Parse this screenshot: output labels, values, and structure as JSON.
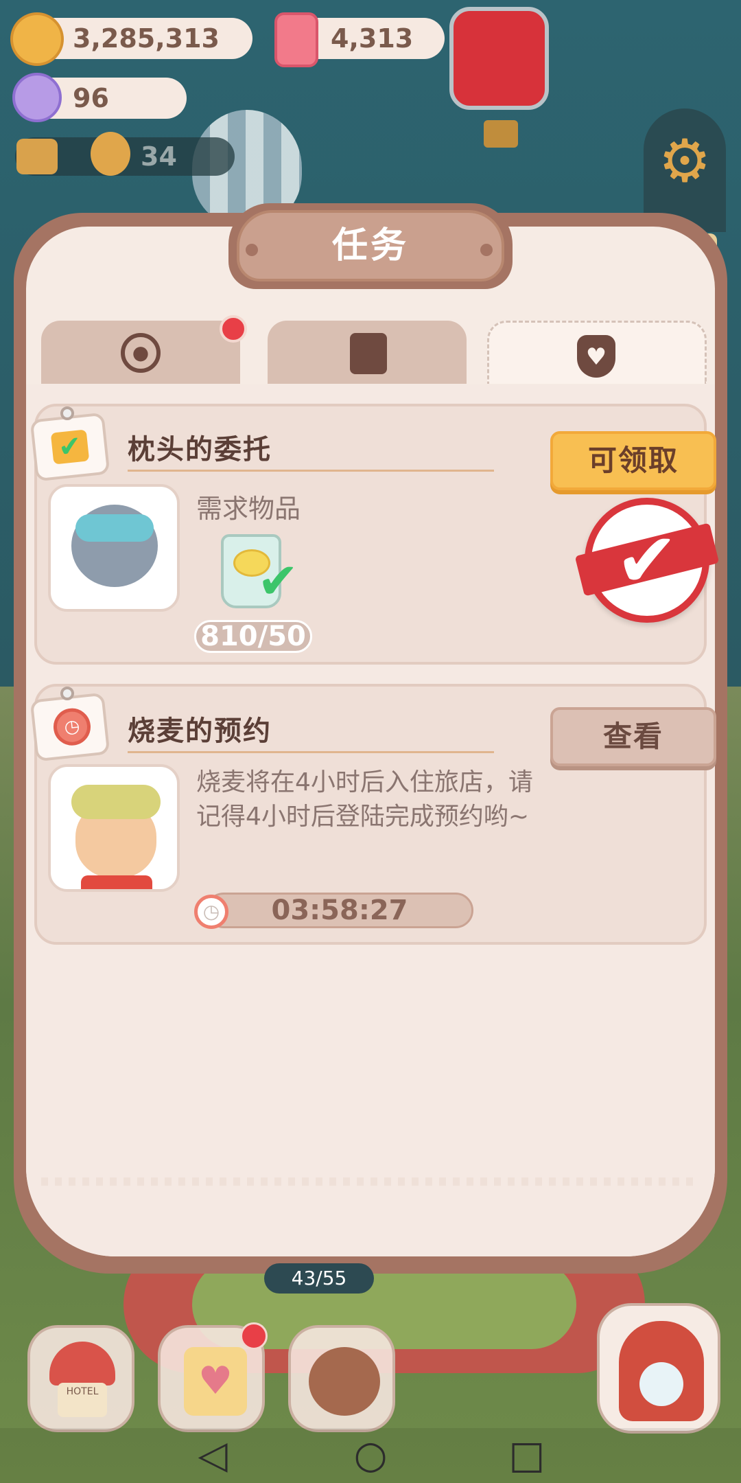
{
  "hud": {
    "cookies": "3,285,313",
    "candles": "4,313",
    "candy": "96",
    "visitors": "34"
  },
  "panel": {
    "title": "任务",
    "tabs": [
      {
        "icon": "paw-badge-icon",
        "active": false,
        "has_notification": true
      },
      {
        "icon": "clipboard-pencil-icon",
        "active": false,
        "has_notification": false
      },
      {
        "icon": "heart-bottle-icon",
        "active": true,
        "has_notification": false
      }
    ]
  },
  "tasks": [
    {
      "title": "枕头的委托",
      "required_label": "需求物品",
      "progress": "810/50",
      "button": "可领取",
      "status": "complete"
    },
    {
      "title": "烧麦的预约",
      "description": "烧麦将在4小时后入住旅店，请记得4小时后登陆完成预约哟~",
      "timer": "03:58:27",
      "button": "查看"
    }
  ],
  "bottom_bar": {
    "hotel_counter": "43/55",
    "hotel_label": "HOTEL"
  },
  "colors": {
    "panel_frame": "#a57463",
    "panel_bg": "#f6ebe4",
    "claim_button": "#f8bf52",
    "stamp_red": "#d9363c",
    "notification": "#e83f47"
  }
}
